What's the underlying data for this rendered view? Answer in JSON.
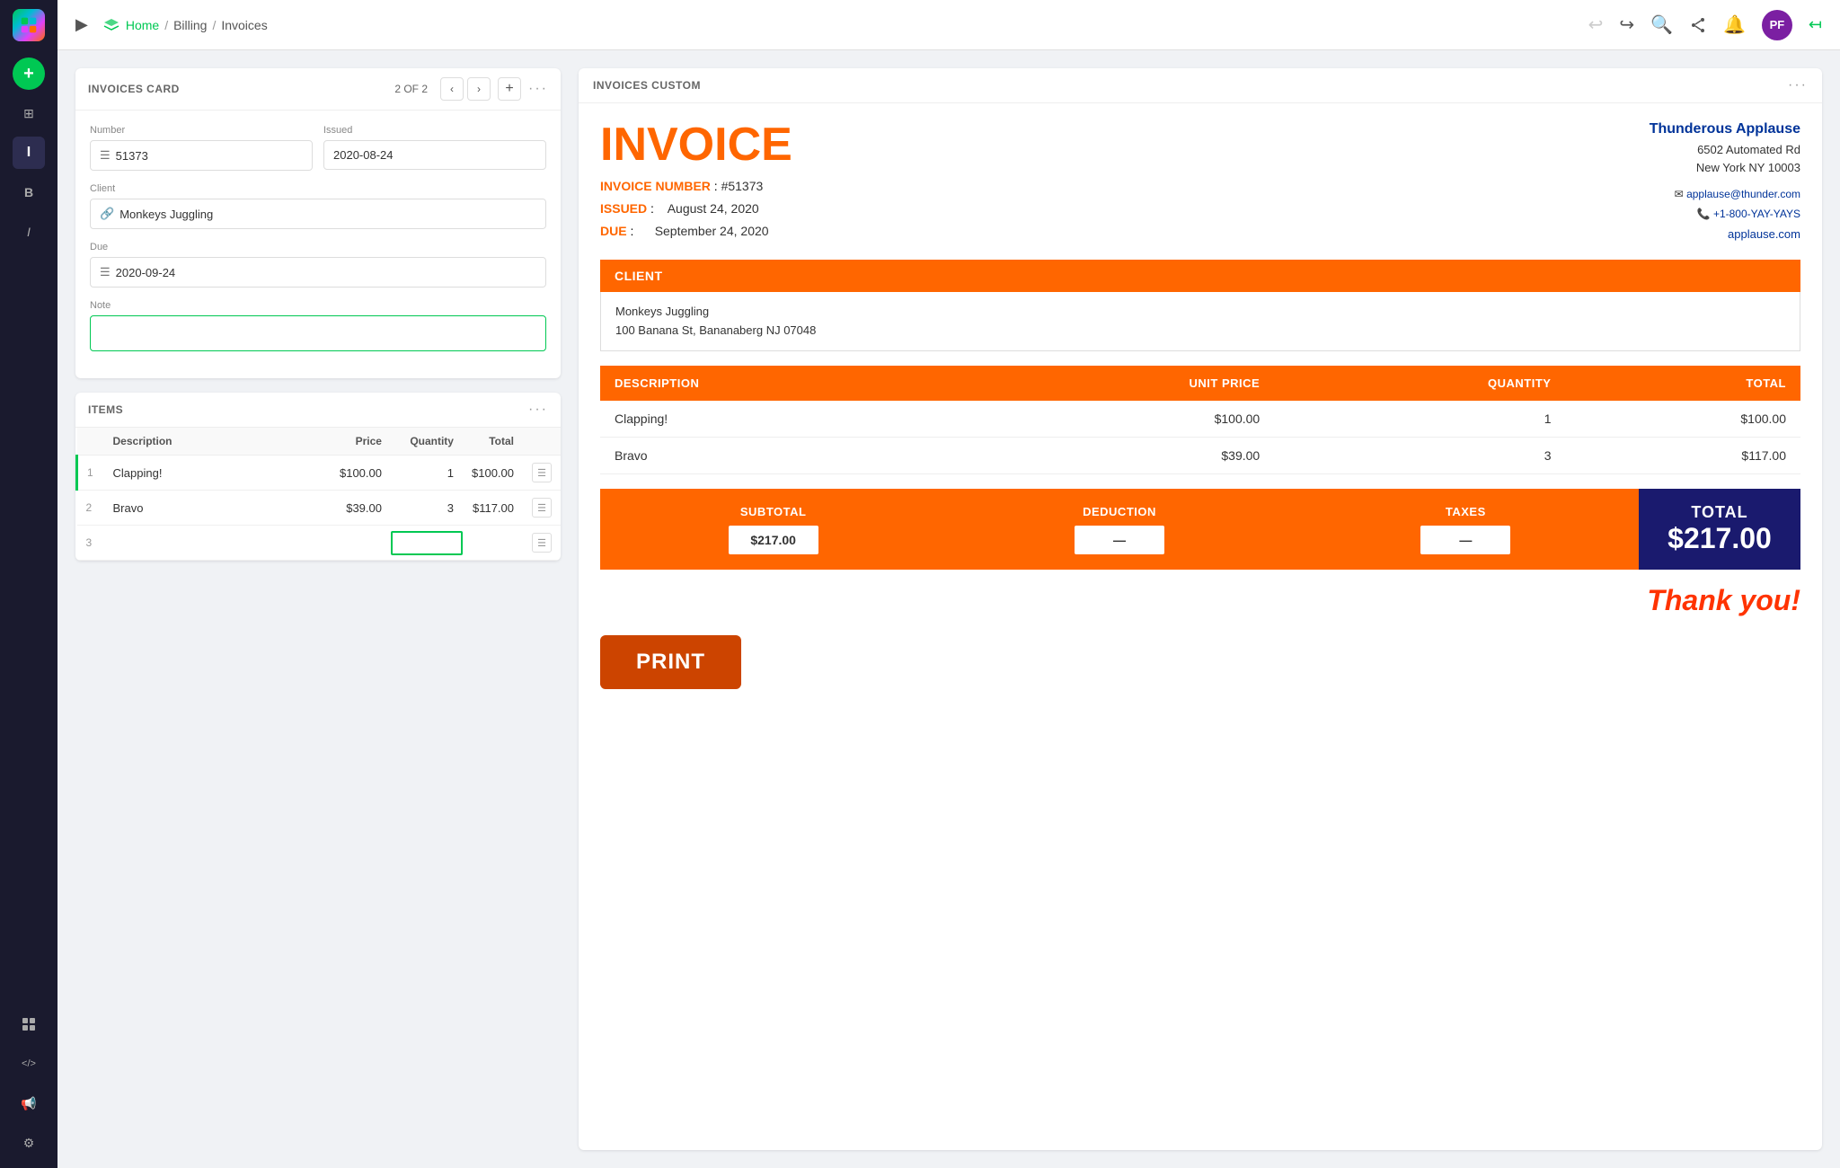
{
  "sidebar": {
    "logo_label": "App Logo",
    "add_btn_label": "+",
    "icons": [
      {
        "name": "grid-icon",
        "symbol": "⊞",
        "active": false
      },
      {
        "name": "document-i-icon",
        "symbol": "I",
        "active": true
      },
      {
        "name": "bold-b-icon",
        "symbol": "B",
        "active": false
      },
      {
        "name": "italic-i-icon",
        "symbol": "I",
        "active": false
      },
      {
        "name": "grid-layout-icon",
        "symbol": "⊞",
        "active": false
      },
      {
        "name": "code-icon",
        "symbol": "</>",
        "active": false
      },
      {
        "name": "megaphone-icon",
        "symbol": "📢",
        "active": false
      },
      {
        "name": "settings-circle-icon",
        "symbol": "⚙",
        "active": false
      }
    ]
  },
  "topbar": {
    "expand_icon": "▶",
    "breadcrumb": {
      "home": "Home",
      "sep1": "/",
      "billing": "Billing",
      "sep2": "/",
      "invoices": "Invoices"
    },
    "undo_icon": "↩",
    "redo_icon": "↪",
    "search_icon": "🔍",
    "share_icon": "⤴",
    "bell_icon": "🔔",
    "avatar_initials": "PF",
    "collapse_icon": "↤"
  },
  "card_section": {
    "title": "INVOICES Card",
    "pagination": "2 OF 2",
    "fields": {
      "number_label": "Number",
      "number_value": "51373",
      "issued_label": "Issued",
      "issued_value": "2020-08-24",
      "client_label": "Client",
      "client_value": "Monkeys Juggling",
      "due_label": "Due",
      "due_value": "2020-09-24",
      "note_label": "Note",
      "note_placeholder": ""
    }
  },
  "items_section": {
    "title": "ITEMS",
    "columns": [
      "",
      "Description",
      "Price",
      "Quantity",
      "Total",
      ""
    ],
    "rows": [
      {
        "num": "1",
        "description": "Clapping!",
        "price": "$100.00",
        "quantity": "1",
        "total": "$100.00"
      },
      {
        "num": "2",
        "description": "Bravo",
        "price": "$39.00",
        "quantity": "3",
        "total": "$117.00"
      },
      {
        "num": "3",
        "description": "",
        "price": "",
        "quantity": "",
        "total": ""
      }
    ]
  },
  "invoice_preview": {
    "panel_title": "INVOICES Custom",
    "main_title": "INVOICE",
    "invoice_number_label": "INVOICE NUMBER",
    "invoice_number_value": "#51373",
    "issued_label": "ISSUED",
    "issued_value": "August 24, 2020",
    "due_label": "DUE",
    "due_value": "September 24, 2020",
    "company": {
      "name": "Thunderous Applause",
      "address_line1": "6502 Automated Rd",
      "address_line2": "New York NY 10003",
      "email": "applause@thunder.com",
      "phone": "+1-800-YAY-YAYS",
      "website": "applause.com"
    },
    "client_section_label": "CLIENT",
    "client_name": "Monkeys Juggling",
    "client_address": "100 Banana St, Bananaberg NJ 07048",
    "table_headers": {
      "description": "DESCRIPTION",
      "unit_price": "UNIT PRICE",
      "quantity": "QUANTITY",
      "total": "TOTAL"
    },
    "items": [
      {
        "description": "Clapping!",
        "unit_price": "$100.00",
        "quantity": "1",
        "total": "$100.00"
      },
      {
        "description": "Bravo",
        "unit_price": "$39.00",
        "quantity": "3",
        "total": "$117.00"
      }
    ],
    "totals": {
      "subtotal_label": "SUBTOTAL",
      "subtotal_value": "$217.00",
      "deduction_label": "DEDUCTION",
      "deduction_value": "—",
      "taxes_label": "TAXES",
      "taxes_value": "—",
      "total_label": "TOTAL",
      "total_value": "$217.00"
    },
    "thank_you": "Thank you!",
    "print_btn": "PRINT"
  }
}
